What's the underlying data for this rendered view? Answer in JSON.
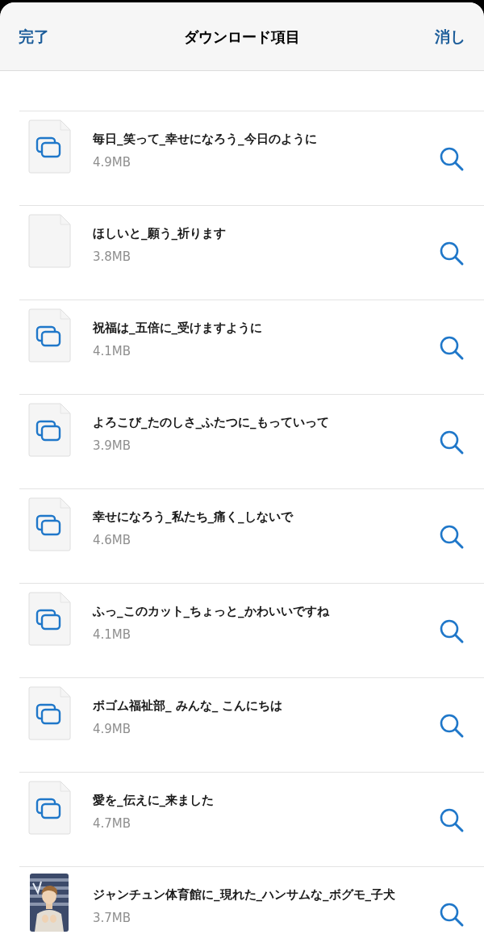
{
  "header": {
    "left_button": "完了",
    "title": "ダウンロード項目",
    "right_button": "消し"
  },
  "items": [
    {
      "kind": "document",
      "name": "毎日_笑って_幸せになろう_今日のように",
      "size": "4.9MB"
    },
    {
      "kind": "blank",
      "name": "ほしいと_願う_祈ります",
      "size": "3.8MB"
    },
    {
      "kind": "document",
      "name": "祝福は_五倍に_受けますように",
      "size": "4.1MB"
    },
    {
      "kind": "document",
      "name": "よろこび_たのしさ_ふたつに_もっていって",
      "size": "3.9MB"
    },
    {
      "kind": "document",
      "name": "幸せになろう_私たち_痛く_しないで",
      "size": "4.6MB"
    },
    {
      "kind": "document",
      "name": "ふっ_このカット_ちょっと_かわいいですね",
      "size": "4.1MB"
    },
    {
      "kind": "document",
      "name": "ボゴム福祉部_ みんな_ こんにちは",
      "size": "4.9MB"
    },
    {
      "kind": "document",
      "name": "愛を_伝えに_来ました",
      "size": "4.7MB"
    },
    {
      "name": "ジャンチュン体育館に_現れた_ハンサムな_ボグモ_子犬",
      "size": "3.7MB"
    }
  ]
}
